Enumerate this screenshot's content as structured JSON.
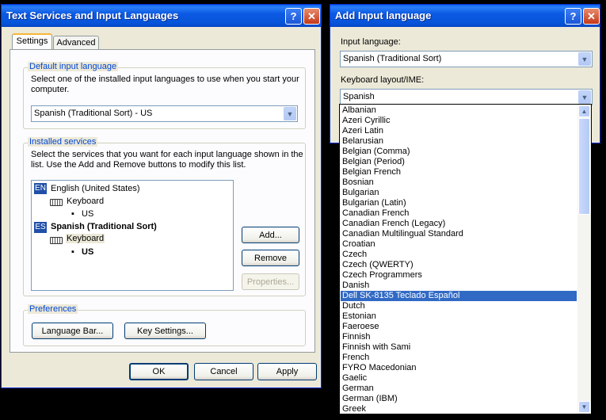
{
  "dlg1": {
    "title": "Text Services and Input Languages",
    "tabs": [
      "Settings",
      "Advanced"
    ],
    "default_group": {
      "legend": "Default input language",
      "desc": "Select one of the installed input languages to use when you start your computer.",
      "value": "Spanish (Traditional Sort) - US"
    },
    "services": {
      "legend": "Installed services",
      "desc": "Select the services that you want for each input language shown in the list. Use the Add and Remove buttons to modify this list.",
      "tree": [
        {
          "badge": "EN",
          "label": "English (United States)",
          "kb": "Keyboard",
          "layout": "US"
        },
        {
          "badge": "ES",
          "label": "Spanish (Traditional Sort)",
          "kb": "Keyboard",
          "layout": "US"
        }
      ],
      "add": "Add...",
      "remove": "Remove",
      "properties": "Properties..."
    },
    "prefs": {
      "legend": "Preferences",
      "langbar": "Language Bar...",
      "keysettings": "Key Settings..."
    },
    "ok": "OK",
    "cancel": "Cancel",
    "apply": "Apply"
  },
  "dlg2": {
    "title": "Add Input language",
    "input_label": "Input language:",
    "input_value": "Spanish (Traditional Sort)",
    "kb_label": "Keyboard layout/IME:",
    "kb_value": "Spanish",
    "selected": "Dell SK-8135 Teclado Español",
    "layouts": [
      "Albanian",
      "Azeri Cyrillic",
      "Azeri Latin",
      "Belarusian",
      "Belgian (Comma)",
      "Belgian (Period)",
      "Belgian French",
      "Bosnian",
      "Bulgarian",
      "Bulgarian (Latin)",
      "Canadian French",
      "Canadian French (Legacy)",
      "Canadian Multilingual Standard",
      "Croatian",
      "Czech",
      "Czech (QWERTY)",
      "Czech Programmers",
      "Danish",
      "Dell SK-8135 Teclado Español",
      "Dutch",
      "Estonian",
      "Faeroese",
      "Finnish",
      "Finnish with Sami",
      "French",
      "FYRO Macedonian",
      "Gaelic",
      "German",
      "German (IBM)",
      "Greek"
    ]
  }
}
